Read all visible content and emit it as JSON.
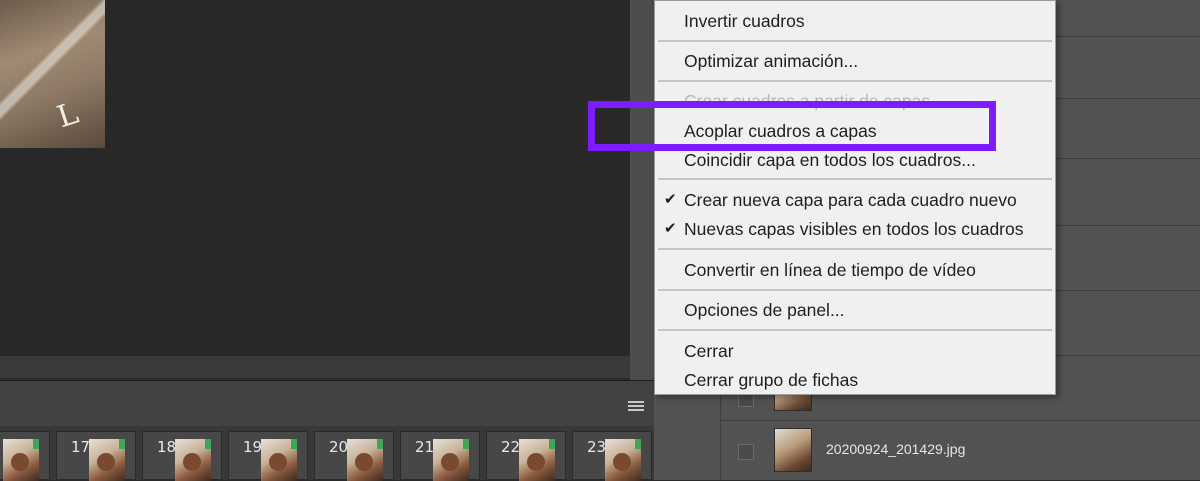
{
  "menu": {
    "items": [
      {
        "label": "Invertir cuadros",
        "checked": false,
        "disabled": false
      },
      {
        "label": "Optimizar animación...",
        "checked": false,
        "disabled": false
      },
      {
        "label": "Crear cuadros a partir de capas",
        "checked": false,
        "disabled": true
      },
      {
        "label": "Acoplar cuadros a capas",
        "checked": false,
        "disabled": false
      },
      {
        "label": "Coincidir capa en todos los cuadros...",
        "checked": false,
        "disabled": false
      },
      {
        "label": "Crear nueva capa para cada cuadro nuevo",
        "checked": true,
        "disabled": false
      },
      {
        "label": "Nuevas capas visibles en todos los cuadros",
        "checked": true,
        "disabled": false
      },
      {
        "label": "Convertir en línea de tiempo de vídeo",
        "checked": false,
        "disabled": false
      },
      {
        "label": "Opciones de panel...",
        "checked": false,
        "disabled": false
      },
      {
        "label": "Cerrar",
        "checked": false,
        "disabled": false
      },
      {
        "label": "Cerrar grupo de fichas",
        "checked": false,
        "disabled": false
      }
    ],
    "check_glyph": "✔"
  },
  "highlight": {
    "color": "#7f1bff",
    "target": "Acoplar cuadros a capas"
  },
  "timeline": {
    "frames": [
      "",
      "17",
      "18",
      "19",
      "20",
      "21",
      "22",
      "23"
    ]
  },
  "layers": {
    "items": [
      {
        "name": ""
      },
      {
        "name": "20200924_201429.jpg"
      }
    ]
  },
  "canvas": {
    "glyph": "L"
  },
  "icons": {
    "panel_menu": "hamburger-menu-icon",
    "check": "checkmark-icon"
  }
}
